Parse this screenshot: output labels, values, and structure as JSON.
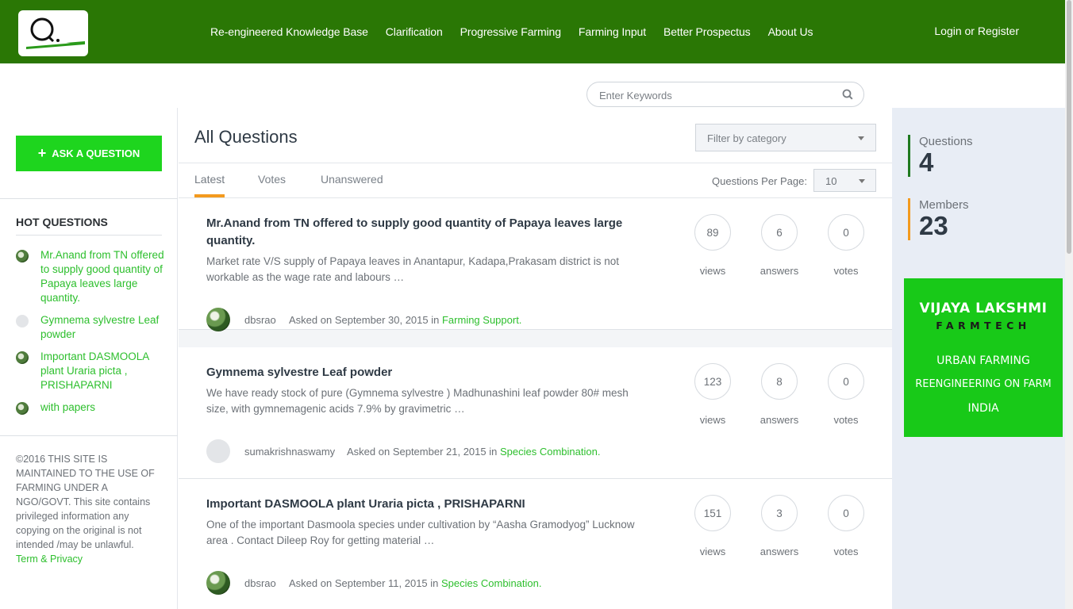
{
  "header": {
    "logo_letter": "Q",
    "nav": [
      "Re-engineered Knowledge Base",
      "Clarification",
      "Progressive Farming",
      "Farming Input",
      "Better Prospectus",
      "About Us"
    ],
    "login": "Login or Register"
  },
  "search": {
    "placeholder": "Enter Keywords",
    "icon": "search-icon"
  },
  "sidebar": {
    "ask_button": "ASK A QUESTION",
    "hot_title": "HOT QUESTIONS",
    "hot_questions": [
      {
        "title": "Mr.Anand from TN offered to supply good quantity of Papaya leaves large quantity."
      },
      {
        "title": "Gymnema sylvestre Leaf powder"
      },
      {
        "title": "Important DASMOOLA plant Uraria picta , PRISHAPARNI"
      },
      {
        "title": "with papers"
      }
    ],
    "footer_text": "©2016 THIS SITE IS MAINTAINED TO THE USE OF FARMING UNDER A NGO/GOVT. This site contains privileged information any copying on the original is not intended /may be unlawful.",
    "footer_link": "Term & Privacy"
  },
  "main": {
    "title": "All Questions",
    "filter_placeholder": "Filter by category",
    "tabs": [
      "Latest",
      "Votes",
      "Unanswered"
    ],
    "per_page_label": "Questions Per Page:",
    "per_page_value": "10",
    "questions": [
      {
        "title": "Mr.Anand from TN offered to supply good quantity of Papaya leaves large quantity.",
        "excerpt": "Market rate V/S supply of Papaya leaves in Anantapur, Kadapa,Prakasam district is not workable as the wage rate and labours …",
        "author": "dbsrao",
        "asked": "Asked on September 30, 2015 in",
        "category": "Farming Support.",
        "views": "89",
        "answers": "6",
        "votes": "0"
      },
      {
        "title": "Gymnema sylvestre Leaf powder",
        "excerpt": "We have ready stock of pure (Gymnema sylvestre ) Madhunashini leaf powder 80# mesh size, with gymnemagenic acids 7.9% by gravimetric …",
        "author": "sumakrishnaswamy",
        "asked": "Asked on September 21, 2015 in",
        "category": "Species Combination.",
        "views": "123",
        "answers": "8",
        "votes": "0"
      },
      {
        "title": "Important DASMOOLA plant Uraria picta , PRISHAPARNI",
        "excerpt": "One of the important Dasmoola species under cultivation by “Aasha Gramodyog” Lucknow area . Contact Dileep Roy for getting material …",
        "author": "dbsrao",
        "asked": "Asked on September 11, 2015 in",
        "category": "Species Combination.",
        "views": "151",
        "answers": "3",
        "votes": "0"
      }
    ],
    "labels": {
      "views": "views",
      "answers": "answers",
      "votes": "votes"
    }
  },
  "stats": {
    "questions_label": "Questions",
    "questions_value": "4",
    "members_label": "Members",
    "members_value": "23"
  },
  "ad": {
    "line1": "VIJAYA LAKSHMI",
    "line2": "FARMTECH",
    "line3": "URBAN FARMING",
    "line4": "REENGINEERING ON FARM",
    "line5": "INDIA"
  },
  "colors": {
    "header": "#2a7705",
    "accent_green": "#2dbf2d",
    "button_green": "#1ed51e",
    "tab_underline": "#f39a1e"
  }
}
